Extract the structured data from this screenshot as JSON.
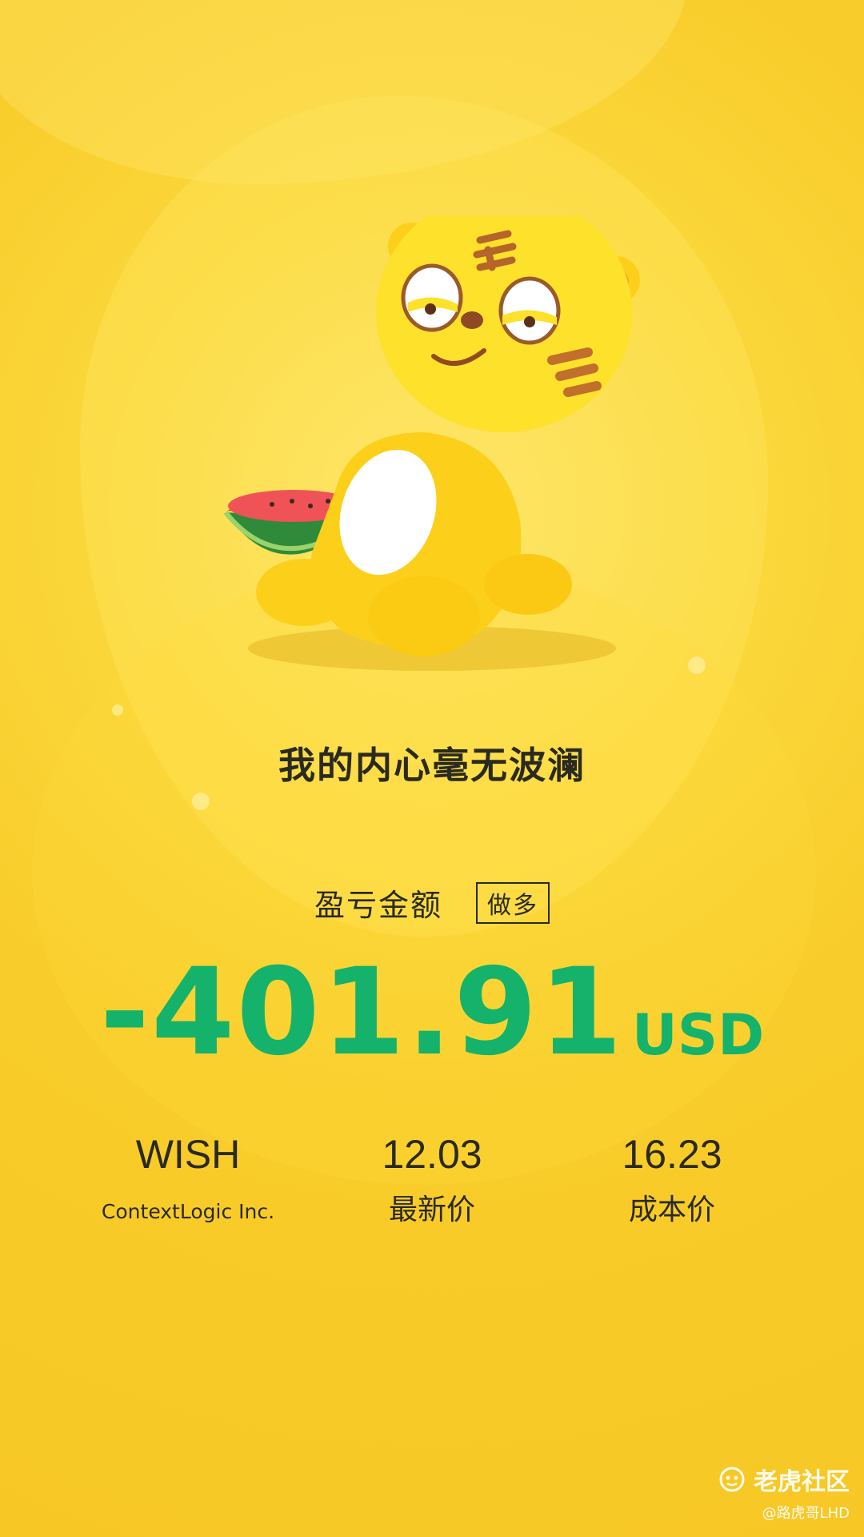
{
  "slogan": "我的内心毫无波澜",
  "pnl": {
    "label": "盈亏金额",
    "side": "做多",
    "value": "-401.91",
    "currency": "USD"
  },
  "stats": {
    "symbol": "WISH",
    "company": "ContextLogic Inc.",
    "latest_price": "12.03",
    "latest_label": "最新价",
    "cost_price": "16.23",
    "cost_label": "成本价"
  },
  "watermark": {
    "brand": "老虎社区",
    "user": "@路虎哥LHD"
  },
  "colors": {
    "background": "#f8cc2a",
    "amount": "#14b26a",
    "text": "#2a2a20"
  },
  "icons": {
    "mascot": "tiger-mascot-with-watermelon",
    "brand": "tiger-logo-icon"
  }
}
